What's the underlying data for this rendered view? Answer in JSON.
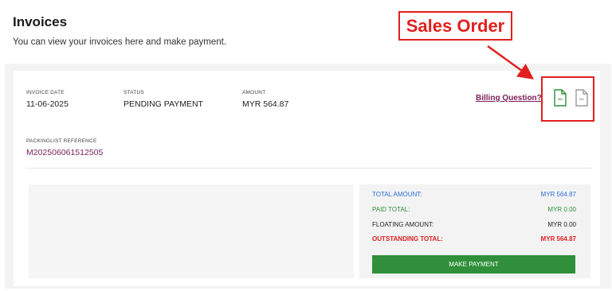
{
  "page": {
    "title": "Invoices",
    "subtitle": "You can view your invoices here and make payment."
  },
  "invoice": {
    "date_label": "INVOICE DATE",
    "date_value": "11-06-2025",
    "status_label": "STATUS",
    "status_value": "PENDING PAYMENT",
    "amount_label": "AMOUNT",
    "amount_value": "MYR 564.87",
    "packinglist_label": "PACKINGLIST REFERENCE",
    "packinglist_value": "M202506061512505",
    "billing_question": "Billing Question?",
    "so_icon_label": "SO",
    "inv_icon_label": "INV"
  },
  "summary": {
    "total_label": "TOTAL AMOUNT:",
    "total_value": "MYR 564.87",
    "paid_label": "PAID TOTAL:",
    "paid_value": "MYR 0.00",
    "floating_label": "FLOATING AMOUNT:",
    "floating_value": "MYR 0.00",
    "outstanding_label": "OUTSTANDING TOTAL:",
    "outstanding_value": "MYR 564.87",
    "pay_button": "MAKE PAYMENT"
  },
  "annotation": {
    "text": "Sales Order"
  },
  "colors": {
    "total": "#2e6fd6",
    "paid": "#2f8f3a",
    "floating": "#222222",
    "outstanding": "#e02020",
    "button": "#2f8f3a",
    "link": "#7a1f5c"
  }
}
